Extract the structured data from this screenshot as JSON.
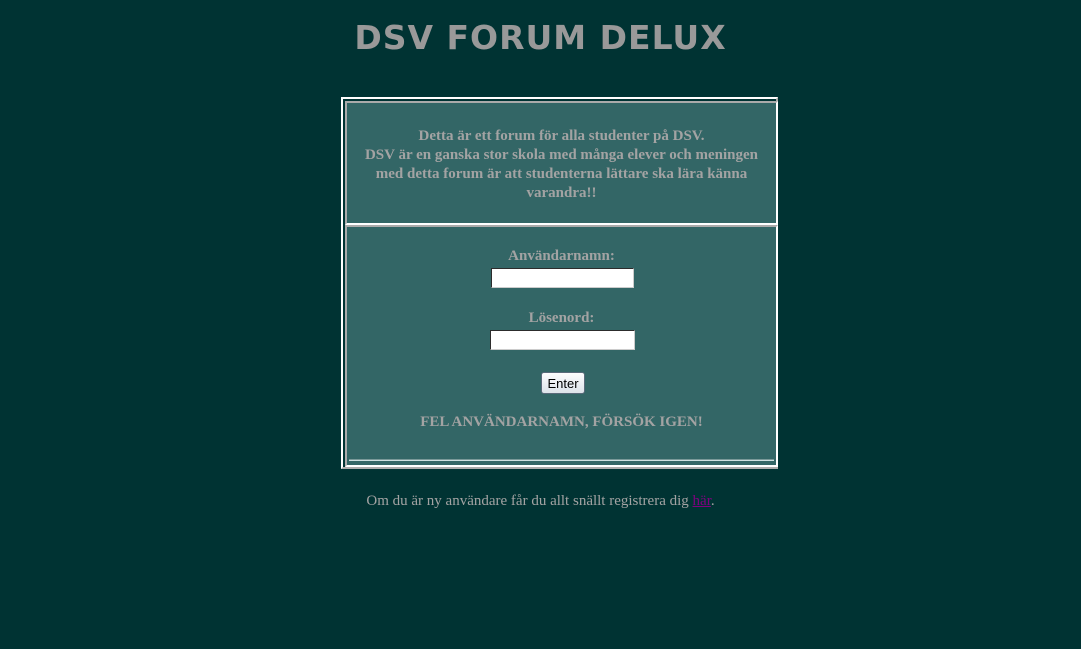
{
  "header": {
    "title": "DSV FORUM DELUX"
  },
  "intro": {
    "line1": "Detta är ett forum för alla studenter på DSV.",
    "line2": "DSV är en ganska stor skola med många elever och meningen med detta forum är att studenterna lättare ska lära känna varandra!!"
  },
  "login": {
    "username_label": "Användarnamn:",
    "username_value": "",
    "password_label": "Lösenord:",
    "password_value": "",
    "submit_label": "Enter",
    "error_message": "FEL ANVÄNDARNAMN, FÖRSÖK IGEN!"
  },
  "footer": {
    "text_before": "Om du är ny användare får du allt snällt registrera dig ",
    "link_label": "här",
    "text_after": "."
  },
  "colors": {
    "background": "#003333",
    "panel": "#336666",
    "text": "#a3a3a3",
    "visited_link": "#800080"
  }
}
